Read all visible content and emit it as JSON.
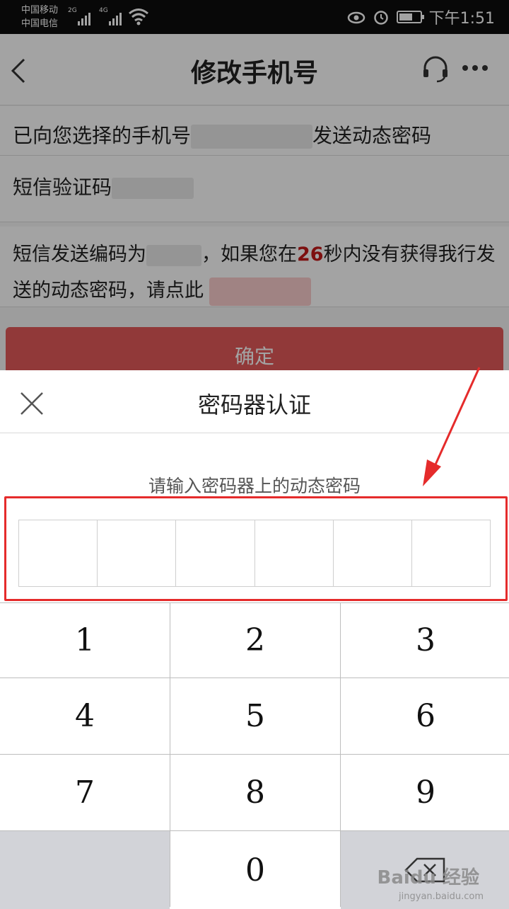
{
  "status_bar": {
    "carrier1": "中国移动",
    "carrier2": "中国电信",
    "net1": "2G",
    "net2": "4G",
    "time": "下午1:51"
  },
  "navbar": {
    "title": "修改手机号",
    "back_icon": "chevron-left-icon",
    "service_icon": "headset-icon",
    "more_icon": "more-dots-icon"
  },
  "form": {
    "sent_prefix": "已向您选择的手机号",
    "sent_suffix": "发送动态密码",
    "sms_label": "短信验证码",
    "notice_part1": "短信发送编码为",
    "notice_part2": "，如果您在",
    "countdown": "26",
    "notice_part3": "秒内没有获得我行发送的动态密码，请点此",
    "confirm_label": "确定"
  },
  "dialog": {
    "title": "密码器认证",
    "prompt": "请输入密码器上的动态密码",
    "pin_length": 6,
    "close_icon": "close-icon"
  },
  "keypad": {
    "keys": [
      "1",
      "2",
      "3",
      "4",
      "5",
      "6",
      "7",
      "8",
      "9",
      "",
      "0",
      ""
    ],
    "backspace_icon": "backspace-icon"
  },
  "watermark": {
    "brand": "Baidu 经验",
    "url": "jingyan.baidu.com"
  },
  "colors": {
    "accent": "#e35a5a",
    "highlight": "#e52b2b",
    "countdown": "#c41a1a"
  }
}
